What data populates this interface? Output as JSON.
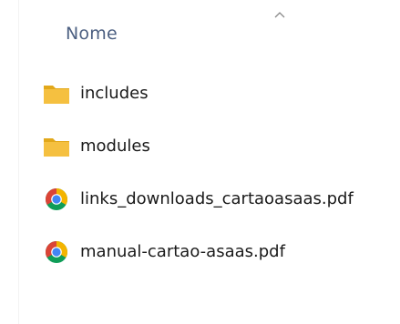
{
  "columns": {
    "name_header": "Nome",
    "sort_direction": "ascending"
  },
  "files": [
    {
      "name": "includes",
      "type": "folder",
      "icon": "folder-icon"
    },
    {
      "name": "modules",
      "type": "folder",
      "icon": "folder-icon"
    },
    {
      "name": "links_downloads_cartaoasaas.pdf",
      "type": "pdf",
      "icon": "chrome-icon"
    },
    {
      "name": "manual-cartao-asaas.pdf",
      "type": "pdf",
      "icon": "chrome-icon"
    }
  ],
  "colors": {
    "folder": "#f5c040",
    "folder_dark": "#e2a81a",
    "header_text": "#4d6082",
    "chrome_red": "#db4437",
    "chrome_yellow": "#f4b400",
    "chrome_green": "#0f9d58",
    "chrome_blue": "#4285f4"
  }
}
